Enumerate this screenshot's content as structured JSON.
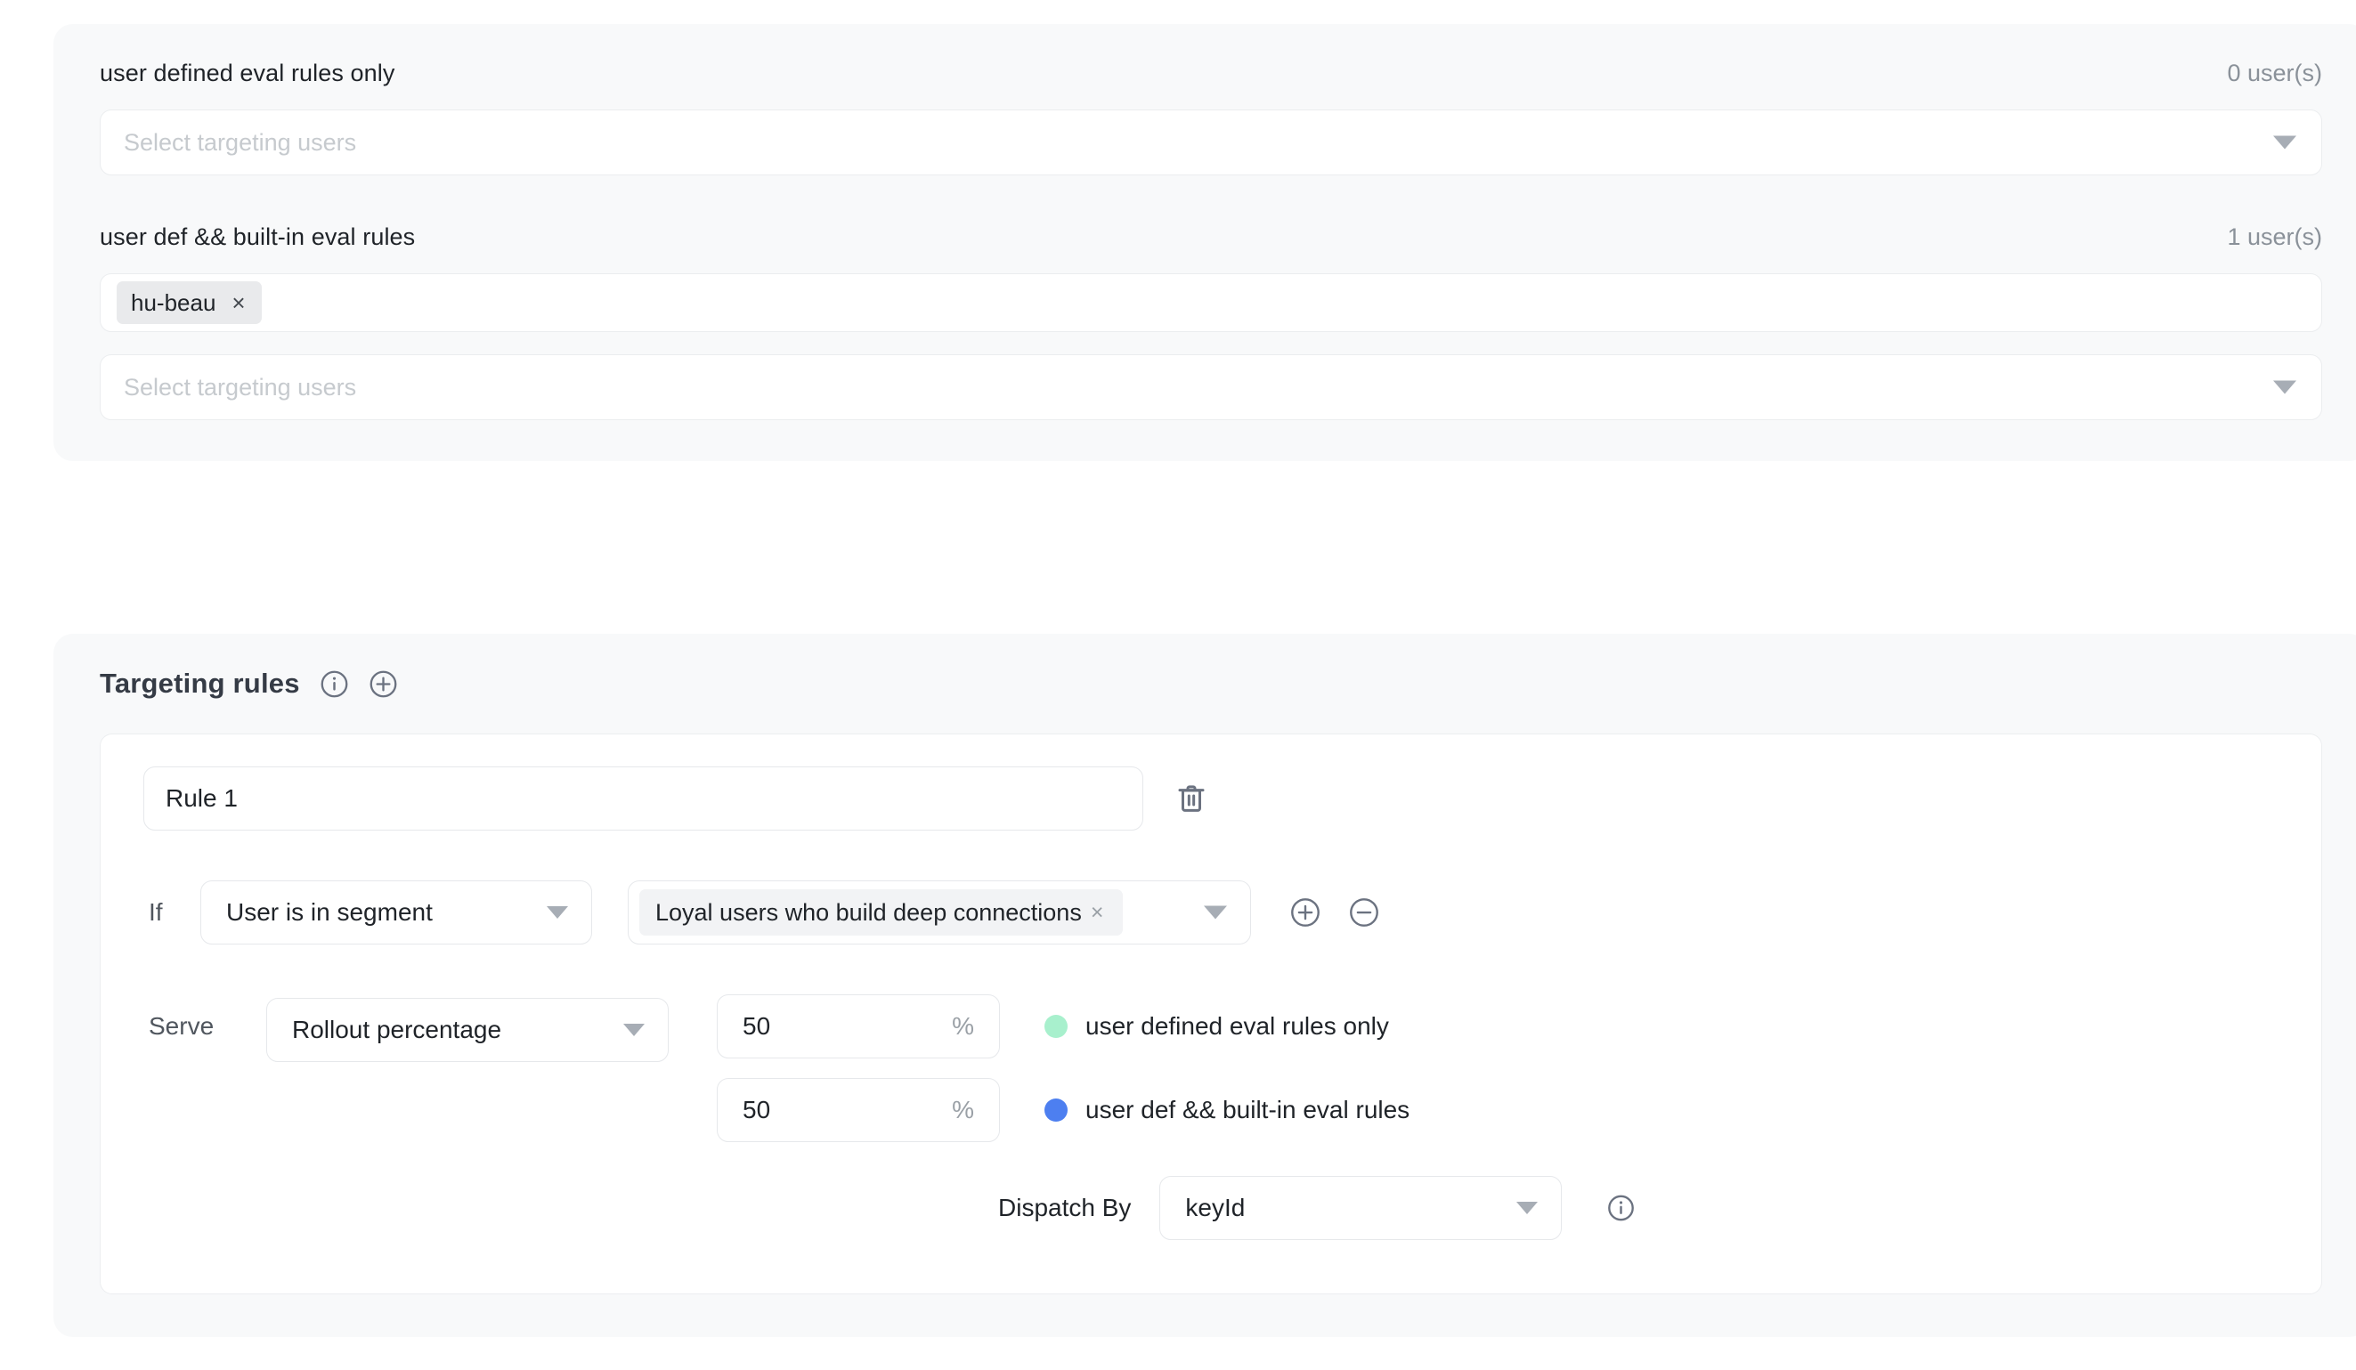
{
  "variations": {
    "items": [
      {
        "name": "user defined eval rules only",
        "count": "0 user(s)",
        "chips": [],
        "placeholder": "Select targeting users"
      },
      {
        "name": "user def && built-in eval rules",
        "count": "1 user(s)",
        "chips": [
          {
            "label": "hu-beau",
            "remove": "×"
          }
        ],
        "placeholder": "Select targeting users"
      }
    ]
  },
  "targeting": {
    "title": "Targeting rules",
    "info_icon": "info-circle-icon",
    "add_icon": "plus-circle-icon",
    "rule": {
      "name": "Rule 1",
      "delete_icon": "trash-icon",
      "if_label": "If",
      "condition_type": "User is in segment",
      "segment_chip": {
        "label": "Loyal users who build deep connections",
        "remove": "×"
      },
      "add_condition_icon": "plus-circle-icon",
      "remove_condition_icon": "minus-circle-icon",
      "serve_label": "Serve",
      "serve_type": "Rollout percentage",
      "percent_sign": "%",
      "rollouts": [
        {
          "value": "50",
          "color": "#a8f0cd",
          "label": "user defined eval rules only"
        },
        {
          "value": "50",
          "color": "#4d7ff0",
          "label": "user def && built-in eval rules"
        }
      ],
      "dispatch_label": "Dispatch By",
      "dispatch_value": "keyId",
      "dispatch_info_icon": "info-circle-icon"
    }
  },
  "colors": {
    "page_bg": "#ffffff",
    "card_bg": "#f8f9fa",
    "border": "#e6e8eb",
    "text": "#1f2328",
    "muted": "#8a9199",
    "placeholder": "#c6cace",
    "icon": "#6b7280"
  }
}
